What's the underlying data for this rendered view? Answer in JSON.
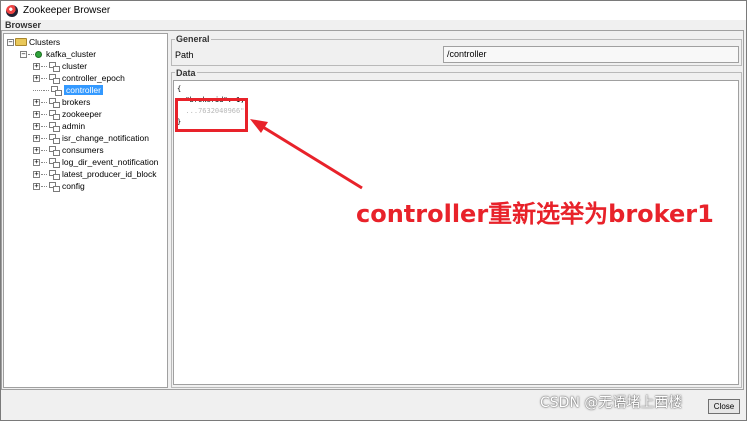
{
  "window": {
    "title": "Zookeeper Browser"
  },
  "browser_label": "Browser",
  "tree": {
    "root": "Clusters",
    "cluster": "kafka_cluster",
    "children": [
      "cluster",
      "controller_epoch",
      "controller",
      "brokers",
      "zookeeper",
      "admin",
      "isr_change_notification",
      "consumers",
      "log_dir_event_notification",
      "latest_producer_id_block",
      "config"
    ],
    "selected": "controller"
  },
  "general": {
    "title": "General",
    "path_label": "Path",
    "path_value": "/controller"
  },
  "data_section": {
    "title": "Data",
    "lines": [
      "{",
      "",
      "  \"brokerid\": 1,",
      "  ...7632040966\"",
      "}"
    ]
  },
  "annotation": {
    "text": "controller重新选举为broker1",
    "color": "#e8222a"
  },
  "close_label": "Close",
  "watermark": "CSDN @无语堵上西楼",
  "colors": {
    "selection": "#3399ff",
    "annotation": "#e8222a"
  }
}
